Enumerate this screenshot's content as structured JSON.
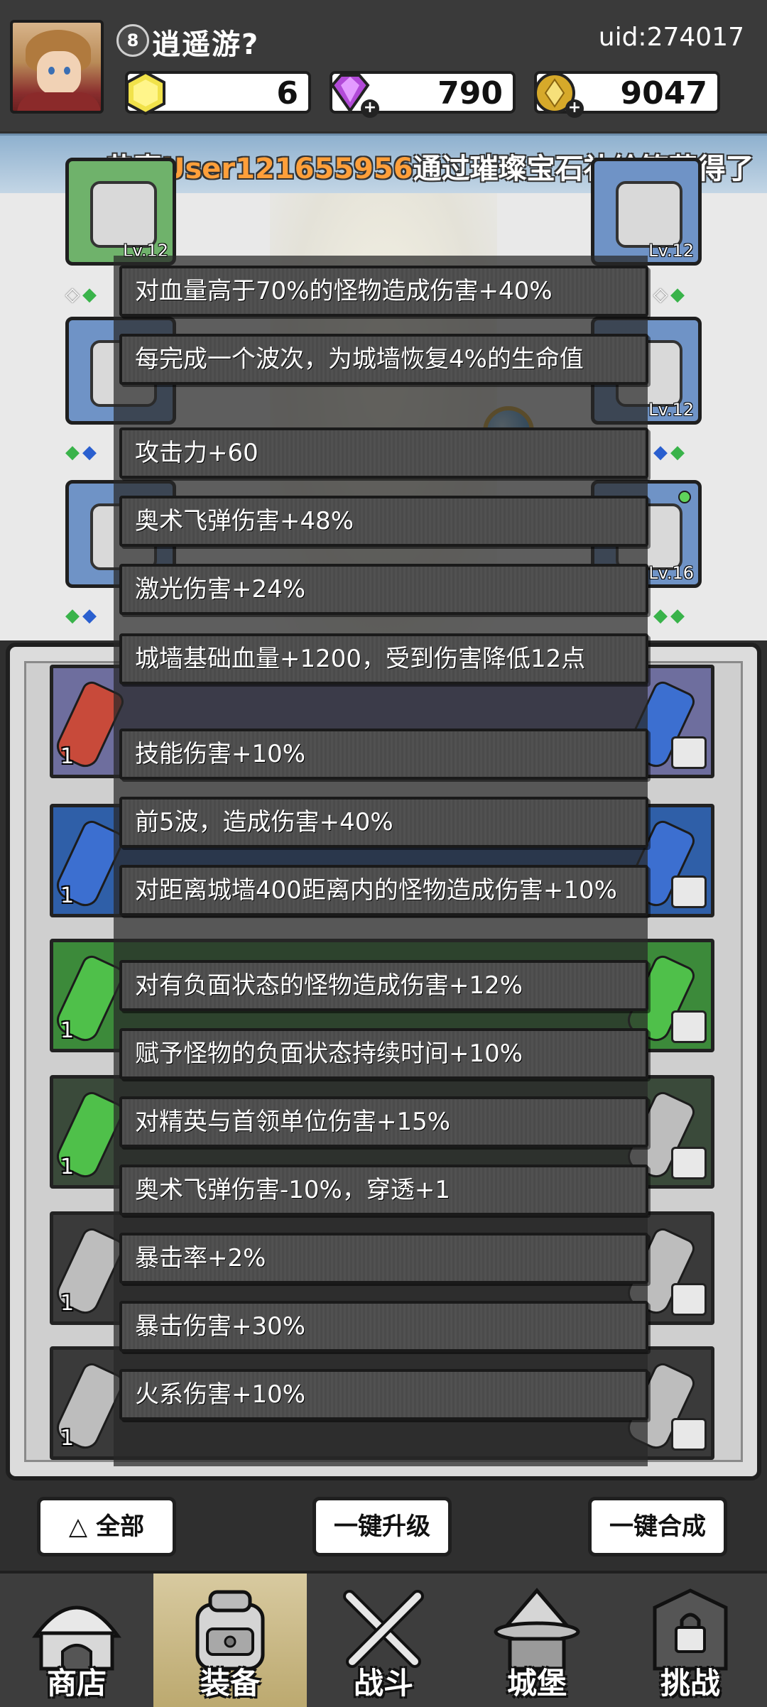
{
  "player": {
    "level": "8",
    "name": "逍遥游?",
    "uid": "uid:274017"
  },
  "resources": {
    "energy": "6",
    "gems": "790",
    "coins": "9047"
  },
  "announcement": {
    "prefix": "恭喜",
    "user": "User121655956",
    "suffix": "通过璀璨宝石补给箱获得了"
  },
  "equipment_slots": {
    "lv_top_left": "Lv.12",
    "lv_top_right": "Lv.12",
    "lv_mid_right": "Lv.12",
    "lv_bottom_right": "Lv.16"
  },
  "affixes": [
    "对血量高于70%的怪物造成伤害+40%",
    "每完成一个波次，为城墙恢复4%的生命值",
    "攻击力+60",
    "奥术飞弹伤害+48%",
    "激光伤害+24%",
    "城墙基础血量+1200，受到伤害降低12点",
    "技能伤害+10%",
    "前5波，造成伤害+40%",
    "对距离城墙400距离内的怪物造成伤害+10%",
    "对有负面状态的怪物造成伤害+12%",
    "赋予怪物的负面状态持续时间+10%",
    "对精英与首领单位伤害+15%",
    "奥术飞弹伤害-10%，穿透+1",
    "暴击率+2%",
    "暴击伤害+30%",
    "火系伤害+10%"
  ],
  "inventory_counts": [
    "1",
    "1",
    "1",
    "1",
    "1",
    "1"
  ],
  "buttons": {
    "filter": "全部",
    "upgrade_all": "一键升级",
    "merge_all": "一键合成"
  },
  "nav": {
    "shop": "商店",
    "equipment": "装备",
    "battle": "战斗",
    "castle": "城堡",
    "challenge": "挑战"
  },
  "colors": {
    "announcement_user": "#ff9f3a",
    "active_tab": "#c9b883",
    "rarity_red": "#c84a3a",
    "rarity_blue": "#2f5fa8",
    "rarity_green": "#3c8a3a",
    "rarity_dark": "#3a3a3a"
  }
}
